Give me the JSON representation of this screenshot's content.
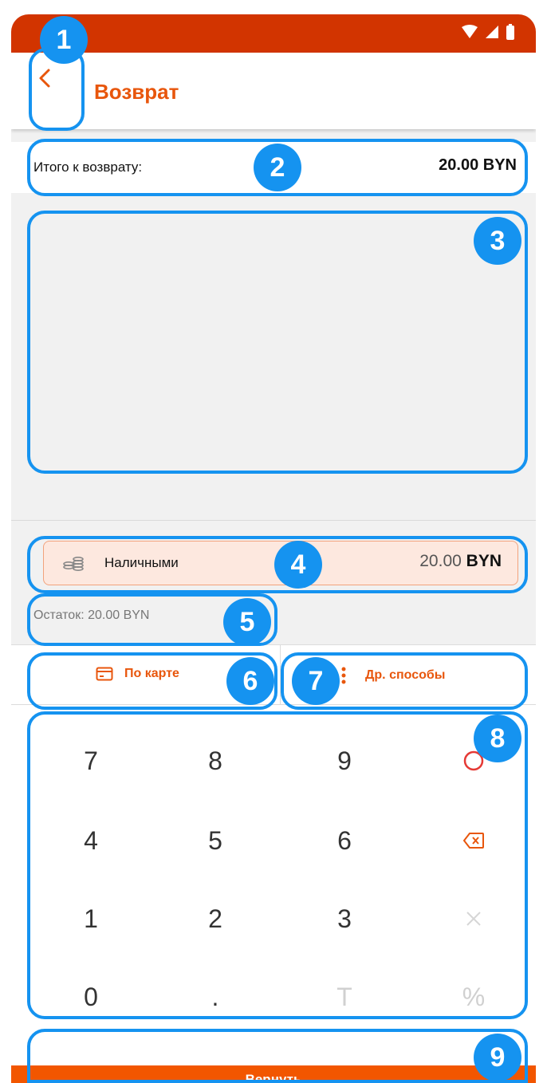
{
  "appbar": {
    "title": "Возврат"
  },
  "total": {
    "label": "Итого к возврату:",
    "value": "20.00 BYN"
  },
  "cash": {
    "label": "Наличными",
    "amount_number": "20.00",
    "amount_currency": "BYN"
  },
  "remainder": {
    "text": "Остаток: 20.00 BYN"
  },
  "methods": {
    "card_label": "По карте",
    "other_label": "Др. способы"
  },
  "keypad": {
    "row1": [
      "7",
      "8",
      "9"
    ],
    "row2": [
      "4",
      "5",
      "6"
    ],
    "row3": [
      "1",
      "2",
      "3"
    ],
    "row4": [
      "0",
      ".",
      "T",
      "%"
    ]
  },
  "action": {
    "label": "Вернуть"
  },
  "colors": {
    "accent": "#e8560c",
    "statusbar": "#d23400",
    "button": "#f25600",
    "annotation": "#1593f0"
  },
  "annotations": [
    "1",
    "2",
    "3",
    "4",
    "5",
    "6",
    "7",
    "8",
    "9"
  ]
}
